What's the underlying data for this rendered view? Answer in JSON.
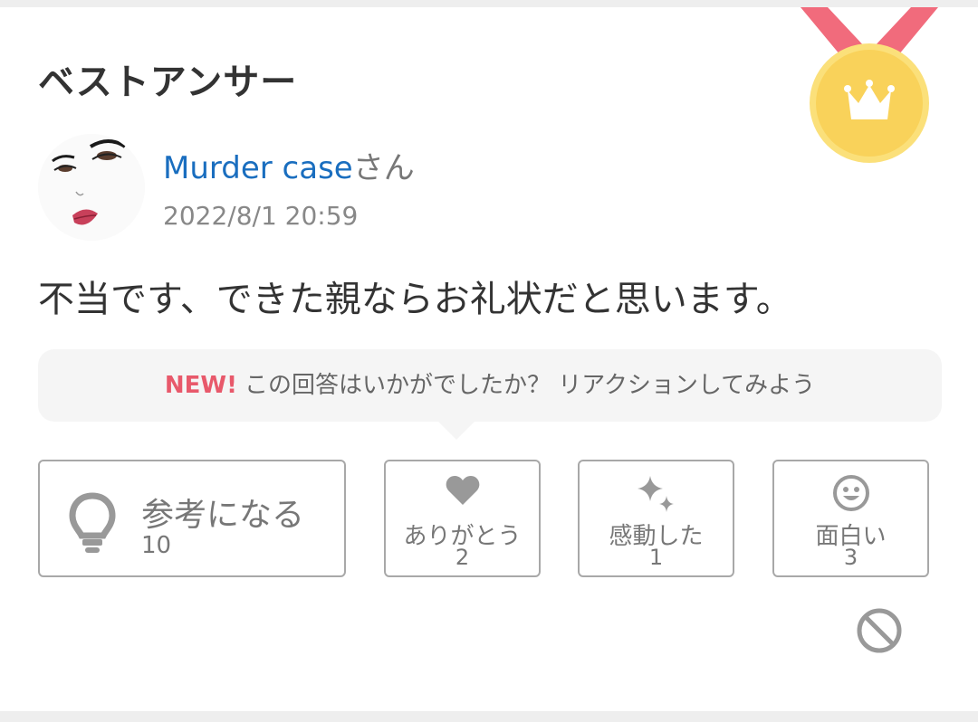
{
  "section_title": "ベストアンサー",
  "colors": {
    "link": "#1a6ebf",
    "new_badge": "#e8596b",
    "medal_gold": "#f9d25a",
    "ribbon": "#f16b7c"
  },
  "answer": {
    "user_name": "Murder case",
    "user_suffix": "さん",
    "date": "2022/8/1 20:59",
    "text": "不当です、できた親ならお礼状だと思います。"
  },
  "reaction_prompt": {
    "badge": "NEW!",
    "text": "この回答はいかがでしたか？ リアクションしてみよう"
  },
  "reactions": [
    {
      "label": "参考になる",
      "count": "10",
      "icon": "lightbulb-icon"
    },
    {
      "label": "ありがとう",
      "count": "2",
      "icon": "heart-icon"
    },
    {
      "label": "感動した",
      "count": "1",
      "icon": "sparkle-icon"
    },
    {
      "label": "面白い",
      "count": "3",
      "icon": "smile-icon"
    }
  ],
  "icons": {
    "medal": "best-answer-medal-icon",
    "block": "block-icon"
  }
}
